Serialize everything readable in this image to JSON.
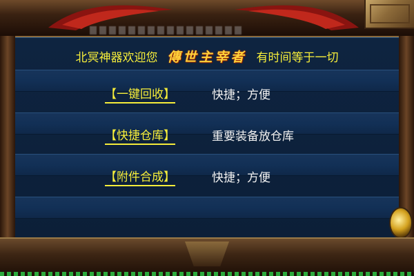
{
  "header": {
    "welcome": "北冥神器欢迎您",
    "brand": "傳世主宰者",
    "slogan": "有时间等于一切"
  },
  "menu": [
    {
      "label": "【一键回收】",
      "description": "快捷；方便"
    },
    {
      "label": "【快捷仓库】",
      "description": "重要装备放仓库"
    },
    {
      "label": "【附件合成】",
      "description": "快捷；方便"
    }
  ],
  "colors": {
    "link": "#f7ee3a",
    "text": "#f2f2f2",
    "panel": "#0e2440",
    "brand": "#ffd23a"
  }
}
